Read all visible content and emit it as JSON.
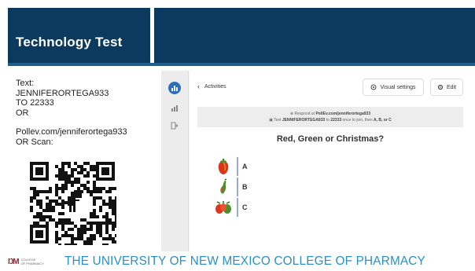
{
  "slide": {
    "title": "Technology Test"
  },
  "instructions": {
    "line1": "Text:",
    "line2": "JENNIFERORTEGA933",
    "line3": "TO 22333",
    "line4": "OR",
    "line5": "Pollev.com/jenniferortega933",
    "line6": "OR Scan:"
  },
  "pollev": {
    "back_label": "Activities",
    "visual_settings_label": "Visual settings",
    "edit_label": "Edit",
    "respond_line1_prefix": "Respond at ",
    "respond_line1_url": "PollEv.com/jenniferortega933",
    "respond_line2_prefix": "Text ",
    "respond_line2_code": "JENNIFERORTEGA933",
    "respond_line2_mid": " to ",
    "respond_line2_num": "22333",
    "respond_line2_suffix": " once to join, then ",
    "respond_line2_options": "A, B, or C",
    "question": "Red, Green or Christmas?",
    "options": [
      {
        "label": "A",
        "icon": "red-pepper-icon"
      },
      {
        "label": "B",
        "icon": "green-pepper-icon"
      },
      {
        "label": "C",
        "icon": "christmas-peppers-icon"
      }
    ]
  },
  "footer": {
    "logo_line1": "COLLEGE",
    "logo_line2": "OF PHARMACY",
    "university": "THE UNIVERSITY OF NEW MEXICO COLLEGE OF PHARMACY"
  },
  "colors": {
    "header": "#0b3a5e",
    "footer_text": "#2a8fc5",
    "accent_blue": "#2d6fba",
    "logo_red": "#b0182e"
  }
}
